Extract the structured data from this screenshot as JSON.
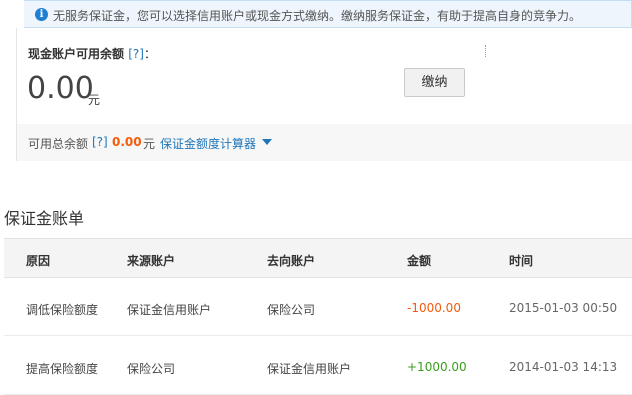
{
  "notice": {
    "icon": "info-icon",
    "message": "无服务保证金，您可以选择信用账户或现金方式缴纳。缴纳服务保证金，有助于提高自身的竞争力。"
  },
  "cash_account": {
    "label": "现金账户可用余额",
    "help": "[?]",
    "colon": "：",
    "amount": "0.00",
    "unit": "元",
    "pay_button": "缴纳"
  },
  "total": {
    "label": "可用总余额",
    "help": "[?]",
    "amount": "0.00",
    "unit": "元",
    "calculator_link": "保证金额度计算器",
    "amount_color": "#f45b0b",
    "link_color": "#1f76b8"
  },
  "ledger": {
    "title": "保证金账单",
    "columns": [
      "原因",
      "来源账户",
      "去向账户",
      "金额",
      "时间"
    ],
    "rows": [
      [
        "调低保险额度",
        "保证金信用账户",
        "保险公司",
        "-1000.00",
        "2015-01-03 00:50"
      ],
      [
        "提高保险额度",
        "保险公司",
        "保证金信用账户",
        "+1000.00",
        "2014-01-03 14:13"
      ]
    ],
    "negative_color": "#f45b0b",
    "positive_color": "#3a9d1e"
  }
}
